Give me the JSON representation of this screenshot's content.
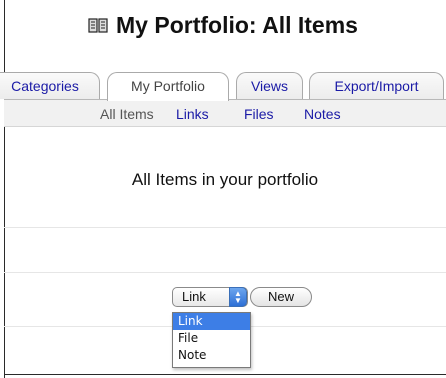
{
  "page": {
    "title": "My Portfolio: All Items"
  },
  "tabs": [
    {
      "label": "Categories"
    },
    {
      "label": "My Portfolio"
    },
    {
      "label": "Views"
    },
    {
      "label": "Export/Import"
    }
  ],
  "active_tab": "My Portfolio",
  "subnav": {
    "all_items": "All Items",
    "links": "Links",
    "files": "Files",
    "notes": "Notes"
  },
  "main": {
    "heading": "All Items in your portfolio"
  },
  "item_type_select": {
    "value": "Link",
    "options": [
      "Link",
      "File",
      "Note"
    ],
    "selected_option": "Link"
  },
  "new_button": {
    "label": "New"
  },
  "colors": {
    "link": "#1a1aa6",
    "selected_option_bg": "#3d7ee6",
    "subnav_bg": "#f1f1f1"
  },
  "icons": {
    "title_icon": "book-icon"
  }
}
